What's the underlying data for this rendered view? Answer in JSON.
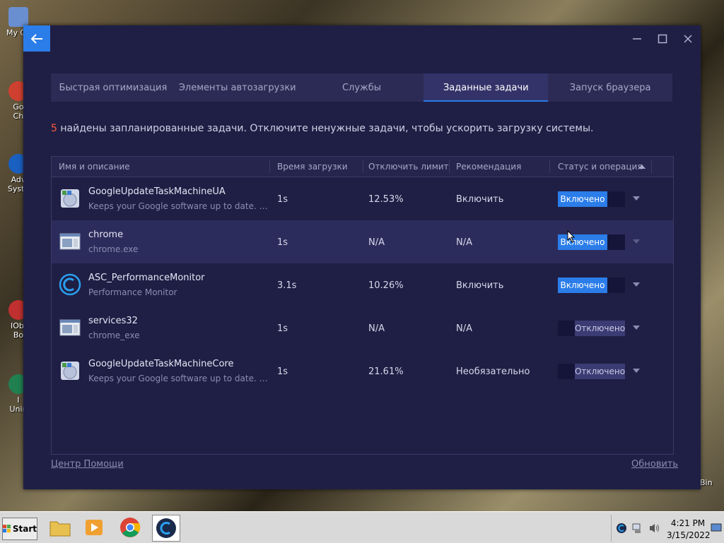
{
  "desktop": {
    "icons": [
      "My Co",
      "Go\nCh",
      "Adv\nSyste",
      "IObi\nBo",
      "I\nUnin"
    ],
    "recycle_label": "Bin"
  },
  "window": {
    "tabs": [
      {
        "label": "Быстрая оптимизация",
        "active": false
      },
      {
        "label": "Элементы автозагрузки",
        "active": false
      },
      {
        "label": "Службы",
        "active": false
      },
      {
        "label": "Заданные задачи",
        "active": true
      },
      {
        "label": "Запуск браузера",
        "active": false
      }
    ],
    "summary": {
      "count": "5",
      "text": "найдены запланированные задачи. Отключите ненужные задачи, чтобы ускорить загрузку системы."
    },
    "columns": [
      "Имя и описание",
      "Время загрузки",
      "Отключить лимит",
      "Рекомендация",
      "Статус и операция"
    ],
    "rows": [
      {
        "name": "GoogleUpdateTaskMachineUA",
        "desc": "Keeps your Google software up to date. I...",
        "time": "1s",
        "limit": "12.53%",
        "rec": "Включить",
        "status": "Включено",
        "on": true,
        "icon": "google-update-icon",
        "highlight": false
      },
      {
        "name": "chrome",
        "desc": "chrome.exe",
        "time": "1s",
        "limit": "N/A",
        "rec": "N/A",
        "status": "Включено",
        "on": true,
        "icon": "window-app-icon",
        "highlight": true
      },
      {
        "name": "ASC_PerformanceMonitor",
        "desc": "Performance Monitor",
        "time": "3.1s",
        "limit": "10.26%",
        "rec": "Включить",
        "status": "Включено",
        "on": true,
        "icon": "asc-logo-icon",
        "highlight": false
      },
      {
        "name": "services32",
        "desc": "chrome_exe",
        "time": "1s",
        "limit": "N/A",
        "rec": "N/A",
        "status": "Отключено",
        "on": false,
        "icon": "window-app-icon",
        "highlight": false
      },
      {
        "name": "GoogleUpdateTaskMachineCore",
        "desc": "Keeps your Google software up to date. I...",
        "time": "1s",
        "limit": "21.61%",
        "rec": "Необязательно",
        "status": "Отключено",
        "on": false,
        "icon": "google-update-icon",
        "highlight": false
      }
    ],
    "footer": {
      "help": "Центр Помощи",
      "refresh": "Обновить"
    }
  },
  "taskbar": {
    "start_label": "Start",
    "time": "4:21 PM",
    "date": "3/15/2022"
  },
  "colors": {
    "accent": "#2b7de9",
    "window_bg": "#1f1f45",
    "count": "#ff5a3c"
  }
}
